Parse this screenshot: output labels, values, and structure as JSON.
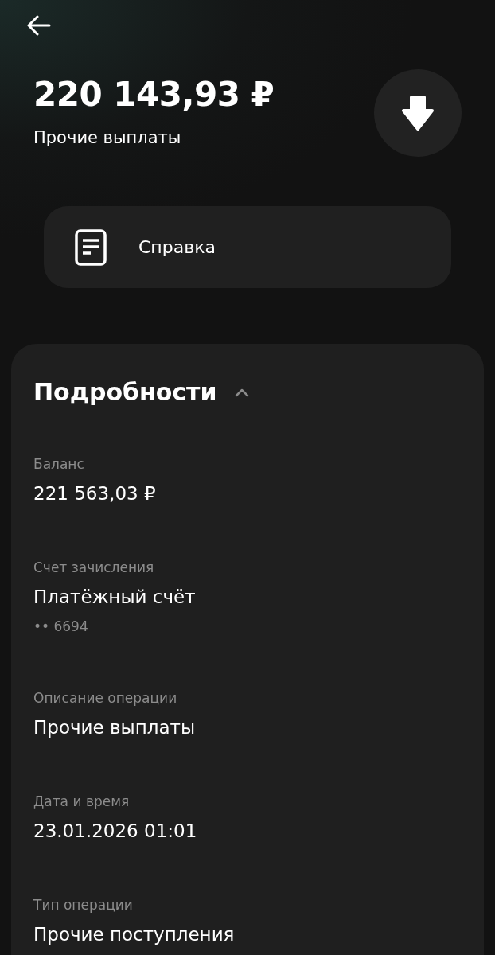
{
  "header": {
    "amount": "220 143,93 ₽",
    "subtitle": "Прочие выплаты"
  },
  "actions": [
    {
      "label": "Справка"
    }
  ],
  "details": {
    "title": "Подробности",
    "expanded": true,
    "rows": [
      {
        "label": "Баланс",
        "value": "221 563,03 ₽"
      },
      {
        "label": "Счет зачисления",
        "value": "Платёжный счёт",
        "note": "•• 6694"
      },
      {
        "label": "Описание операции",
        "value": "Прочие выплаты"
      },
      {
        "label": "Дата и время",
        "value": "23.01.2026 01:01"
      },
      {
        "label": "Тип операции",
        "value": "Прочие поступления"
      }
    ]
  }
}
